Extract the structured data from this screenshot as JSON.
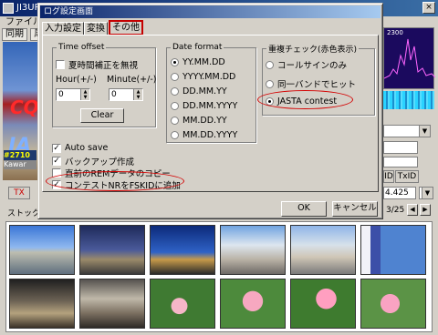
{
  "app": {
    "title": "JI3URS",
    "close_glyph": "×",
    "menu": "ファイル(",
    "tabs": [
      "同期",
      "周"
    ],
    "live_text_a": "CQ",
    "live_text_b": "JA",
    "callsign": "#2710",
    "city": "Kawar",
    "tx_label": "TX",
    "stock_label": "ストック画",
    "spectrum_label": "2300",
    "rp_buttons": [
      "ID",
      "TxID"
    ],
    "frequency": "4.425",
    "page_indicator": "3/25",
    "nav_prev": "◀",
    "nav_next": "▶"
  },
  "dialog": {
    "title": "ログ設定画面",
    "tabs": [
      "入力設定",
      "変換",
      "その他"
    ],
    "time_offset": {
      "legend": "Time offset",
      "ignore_dst_label": "夏時間補正を無視",
      "hour_label": "Hour(+/-)",
      "minute_label": "Minute(+/-)",
      "hour_value": "0",
      "minute_value": "0",
      "clear_label": "Clear"
    },
    "date_format": {
      "legend": "Date format",
      "options": [
        "YY.MM.DD",
        "YYYY.MM.DD",
        "DD.MM.YY",
        "DD.MM.YYYY",
        "MM.DD.YY",
        "MM.DD.YYYY"
      ],
      "selected_index": 0
    },
    "dup_check": {
      "legend": "重複チェック(赤色表示)",
      "options": [
        "コールサインのみ",
        "同一バンドでヒット",
        "JASTA contest"
      ],
      "selected_index": 2
    },
    "checkboxes": [
      {
        "label": "Auto save",
        "checked": true
      },
      {
        "label": "バックアップ作成",
        "checked": true
      },
      {
        "label": "直前のREMデータのコピー",
        "checked": false
      },
      {
        "label": "コンテストNRをFSKIDに追加",
        "checked": true
      }
    ],
    "ok_label": "OK",
    "cancel_label": "キャンセル"
  },
  "colors": {
    "highlight": "#d40000",
    "title_bar": "#0a246a"
  }
}
